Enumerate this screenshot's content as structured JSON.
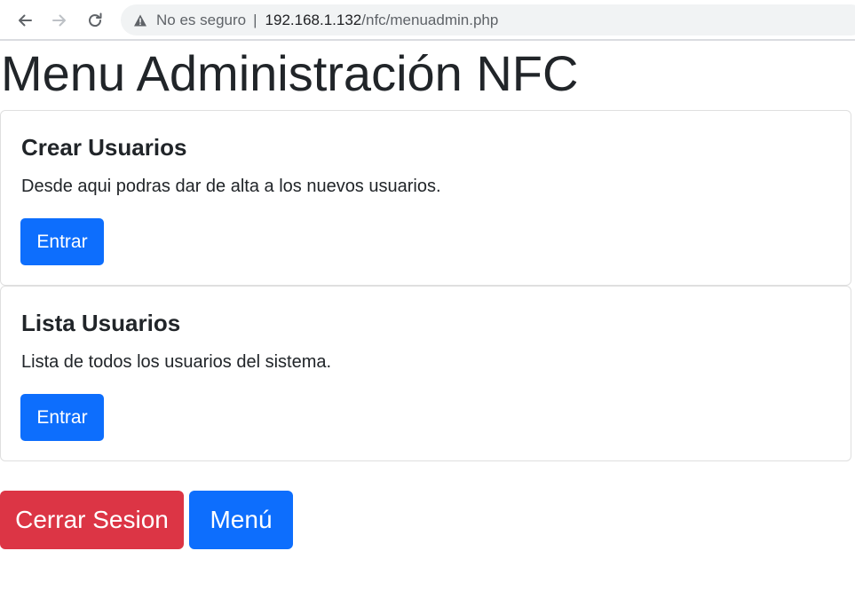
{
  "browser": {
    "security_label": "No es seguro",
    "separator": "|",
    "url_host": "192.168.1.132",
    "url_path": "/nfc/menuadmin.php",
    "icons": [
      "back-arrow-icon",
      "forward-arrow-icon",
      "reload-icon",
      "warning-icon"
    ]
  },
  "page": {
    "title": "Menu Administración NFC"
  },
  "cards": [
    {
      "title": "Crear Usuarios",
      "text": "Desde aqui podras dar de alta a los nuevos usuarios.",
      "button_label": "Entrar"
    },
    {
      "title": "Lista Usuarios",
      "text": "Lista de todos los usuarios del sistema.",
      "button_label": "Entrar"
    }
  ],
  "actions": {
    "logout_label": "Cerrar Sesion",
    "menu_label": "Menú"
  },
  "colors": {
    "primary": "#0d6efd",
    "danger": "#dc3545",
    "text": "#212529"
  }
}
